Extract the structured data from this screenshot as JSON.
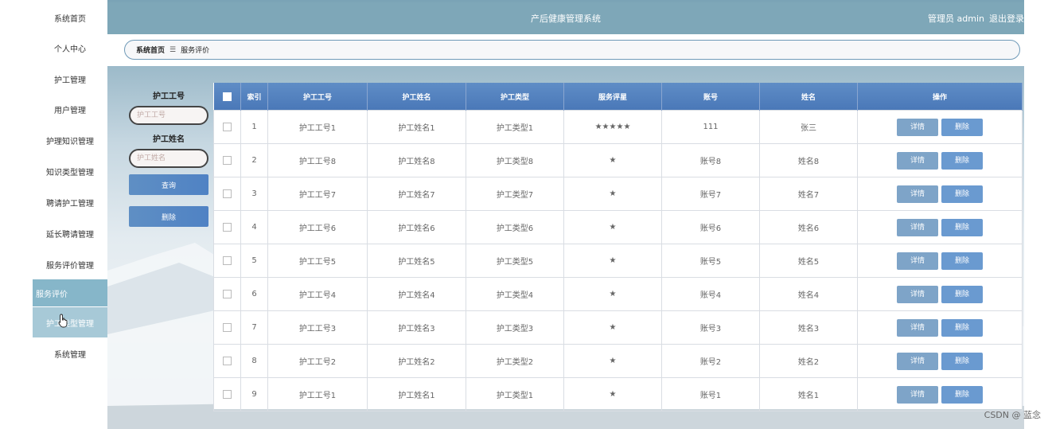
{
  "app": {
    "title": "产后健康管理系统",
    "user_label": "管理员 admin",
    "logout_label": "退出登录"
  },
  "sidebar": {
    "items": [
      {
        "label": "系统首页"
      },
      {
        "label": "个人中心"
      },
      {
        "label": "护工管理"
      },
      {
        "label": "用户管理"
      },
      {
        "label": "护理知识管理"
      },
      {
        "label": "知识类型管理"
      },
      {
        "label": "聘请护工管理"
      },
      {
        "label": "延长聘请管理"
      },
      {
        "label": "服务评价管理"
      },
      {
        "label": "服务评价"
      },
      {
        "label": "护工类型管理"
      },
      {
        "label": "系统管理"
      }
    ]
  },
  "breadcrumb": {
    "home": "系统首页",
    "current": "服务评价"
  },
  "search": {
    "field1_label": "护工工号",
    "field1_placeholder": "护工工号",
    "field2_label": "护工姓名",
    "field2_placeholder": "护工姓名",
    "query_label": "查询",
    "delete_label": "删除"
  },
  "table": {
    "headers": [
      "索引",
      "护工工号",
      "护工姓名",
      "护工类型",
      "服务评星",
      "账号",
      "姓名",
      "操作"
    ],
    "detail_label": "详情",
    "delete_label": "删除",
    "rows": [
      {
        "index": "1",
        "worker_id": "护工工号1",
        "worker_name": "护工姓名1",
        "worker_type": "护工类型1",
        "rating": "★★★★★",
        "account": "111",
        "name": "张三"
      },
      {
        "index": "2",
        "worker_id": "护工工号8",
        "worker_name": "护工姓名8",
        "worker_type": "护工类型8",
        "rating": "★",
        "account": "账号8",
        "name": "姓名8"
      },
      {
        "index": "3",
        "worker_id": "护工工号7",
        "worker_name": "护工姓名7",
        "worker_type": "护工类型7",
        "rating": "★",
        "account": "账号7",
        "name": "姓名7"
      },
      {
        "index": "4",
        "worker_id": "护工工号6",
        "worker_name": "护工姓名6",
        "worker_type": "护工类型6",
        "rating": "★",
        "account": "账号6",
        "name": "姓名6"
      },
      {
        "index": "5",
        "worker_id": "护工工号5",
        "worker_name": "护工姓名5",
        "worker_type": "护工类型5",
        "rating": "★",
        "account": "账号5",
        "name": "姓名5"
      },
      {
        "index": "6",
        "worker_id": "护工工号4",
        "worker_name": "护工姓名4",
        "worker_type": "护工类型4",
        "rating": "★",
        "account": "账号4",
        "name": "姓名4"
      },
      {
        "index": "7",
        "worker_id": "护工工号3",
        "worker_name": "护工姓名3",
        "worker_type": "护工类型3",
        "rating": "★",
        "account": "账号3",
        "name": "姓名3"
      },
      {
        "index": "8",
        "worker_id": "护工工号2",
        "worker_name": "护工姓名2",
        "worker_type": "护工类型2",
        "rating": "★",
        "account": "账号2",
        "name": "姓名2"
      },
      {
        "index": "9",
        "worker_id": "护工工号1",
        "worker_name": "护工姓名1",
        "worker_type": "护工类型1",
        "rating": "★",
        "account": "账号1",
        "name": "姓名1"
      }
    ]
  },
  "watermark": "CSDN @ 蓝念"
}
